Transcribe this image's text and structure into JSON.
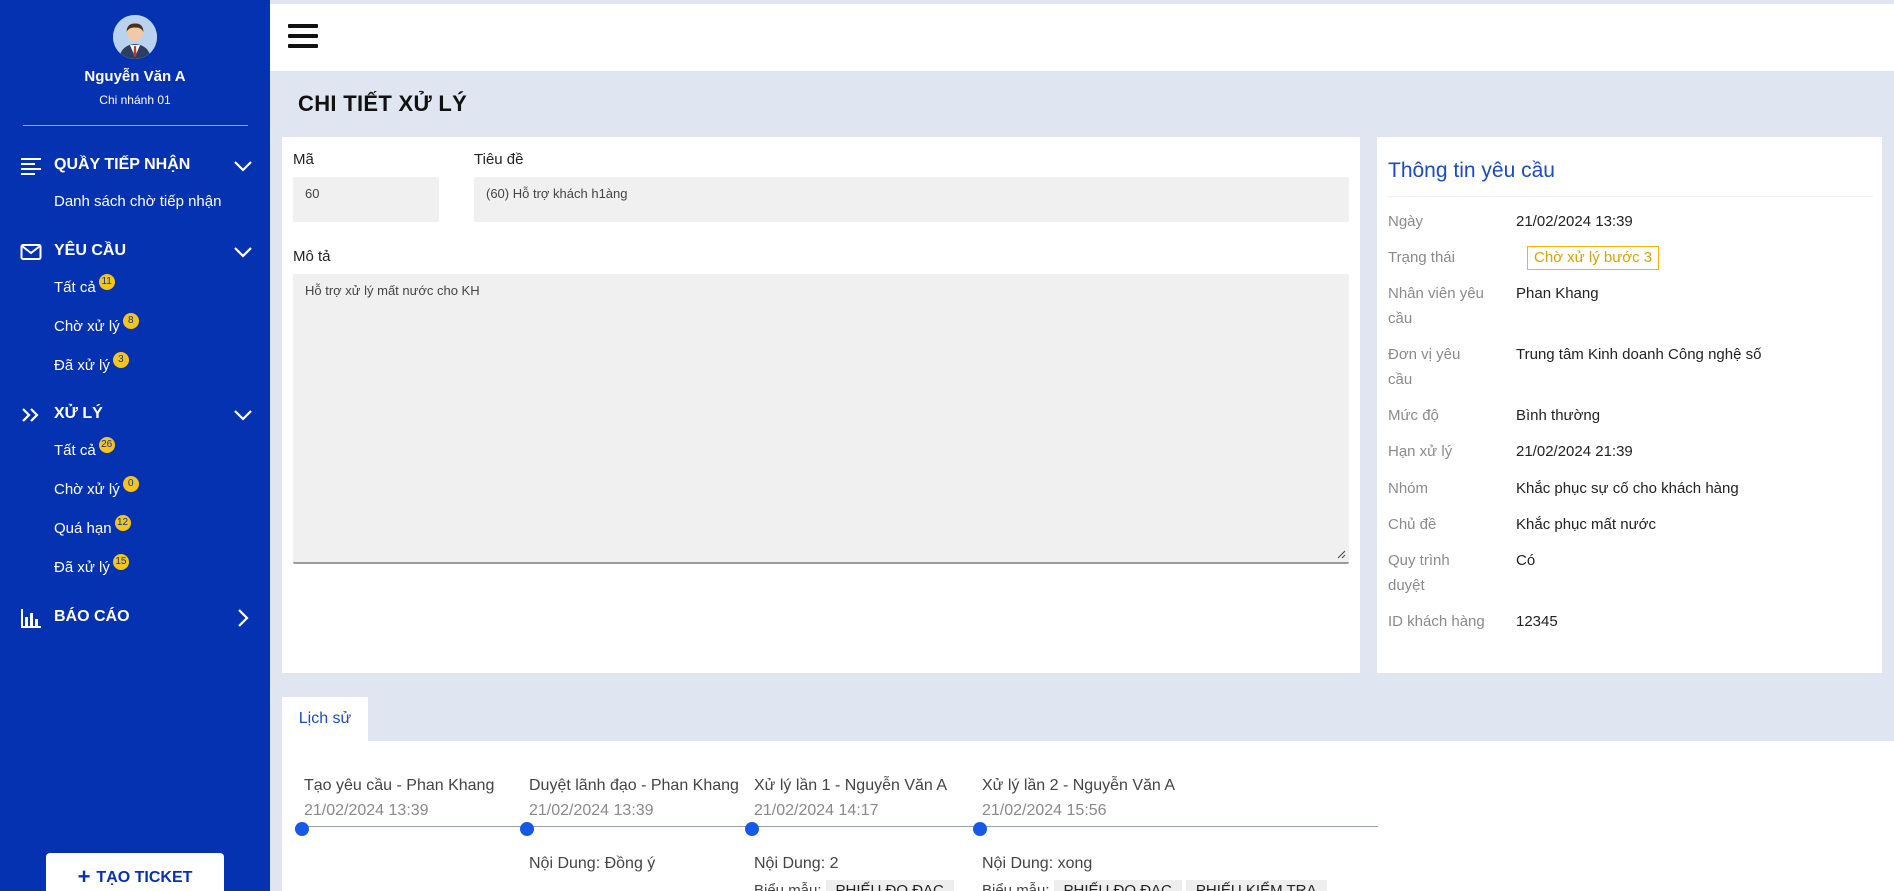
{
  "user": {
    "name": "Nguyễn Văn A",
    "branch": "Chi nhánh 01"
  },
  "sidebar": {
    "sections": [
      {
        "label": "QUẦY TIẾP NHẬN",
        "items": [
          {
            "label": "Danh sách chờ tiếp nhận"
          }
        ]
      },
      {
        "label": "YÊU CẦU",
        "items": [
          {
            "label": "Tất cả",
            "badge": "11"
          },
          {
            "label": "Chờ xử lý",
            "badge": "8"
          },
          {
            "label": "Đã xử lý",
            "badge": "3"
          }
        ]
      },
      {
        "label": "XỬ LÝ",
        "items": [
          {
            "label": "Tất cả",
            "badge": "26"
          },
          {
            "label": "Chờ xử lý",
            "badge": "0"
          },
          {
            "label": "Quá hạn",
            "badge": "12"
          },
          {
            "label": "Đã xử lý",
            "badge": "15"
          }
        ]
      },
      {
        "label": "BÁO CÁO"
      }
    ],
    "ticket_button": "TẠO TICKET"
  },
  "page": {
    "title": "CHI TIẾT XỬ LÝ"
  },
  "form": {
    "code_label": "Mã",
    "code_value": "60",
    "subject_label": "Tiêu đề",
    "subject_value": "(60) Hỗ trợ khách h1àng",
    "desc_label": "Mô tả",
    "desc_value": "Hỗ trợ xử lý mất nước cho KH"
  },
  "info": {
    "title": "Thông tin yêu cầu",
    "rows": [
      {
        "key": "Ngày",
        "value": "21/02/2024 13:39"
      },
      {
        "key": "Trạng thái",
        "value": "Chờ xử lý bước 3"
      },
      {
        "key": "Nhân viên yêu cầu",
        "value": "Phan Khang"
      },
      {
        "key": "Đơn vị yêu cầu",
        "value": "Trung tâm Kinh doanh Công nghệ số"
      },
      {
        "key": "Mức độ",
        "value": "Bình thường"
      },
      {
        "key": "Hạn xử lý",
        "value": "21/02/2024 21:39"
      },
      {
        "key": "Nhóm",
        "value": "Khắc phục sự cố cho khách hàng"
      },
      {
        "key": "Chủ đề",
        "value": "Khắc phục mất nước"
      },
      {
        "key": "Quy trình duyệt",
        "value": "Có"
      },
      {
        "key": "ID khách hàng",
        "value": "12345"
      }
    ]
  },
  "history": {
    "tab_label": "Lịch sử",
    "form_label": "Biểu mẫu:",
    "events": [
      {
        "title": "Tạo yêu cầu - Phan Khang",
        "time": "21/02/2024 13:39"
      },
      {
        "title": "Duyệt lãnh đạo - Phan Khang",
        "time": "21/02/2024 13:39",
        "content": "Nội Dung: Đồng ý"
      },
      {
        "title": "Xử lý lần 1 - Nguyễn Văn A",
        "time": "21/02/2024 14:17",
        "content": "Nội Dung: 2",
        "forms": [
          "PHIẾU ĐO ĐẠC"
        ]
      },
      {
        "title": "Xử lý lần 2 - Nguyễn Văn A",
        "time": "21/02/2024 15:56",
        "content": "Nội Dung: xong",
        "forms": [
          "PHIẾU ĐO ĐẠC",
          "PHIẾU KIỂM TRA"
        ]
      }
    ]
  }
}
